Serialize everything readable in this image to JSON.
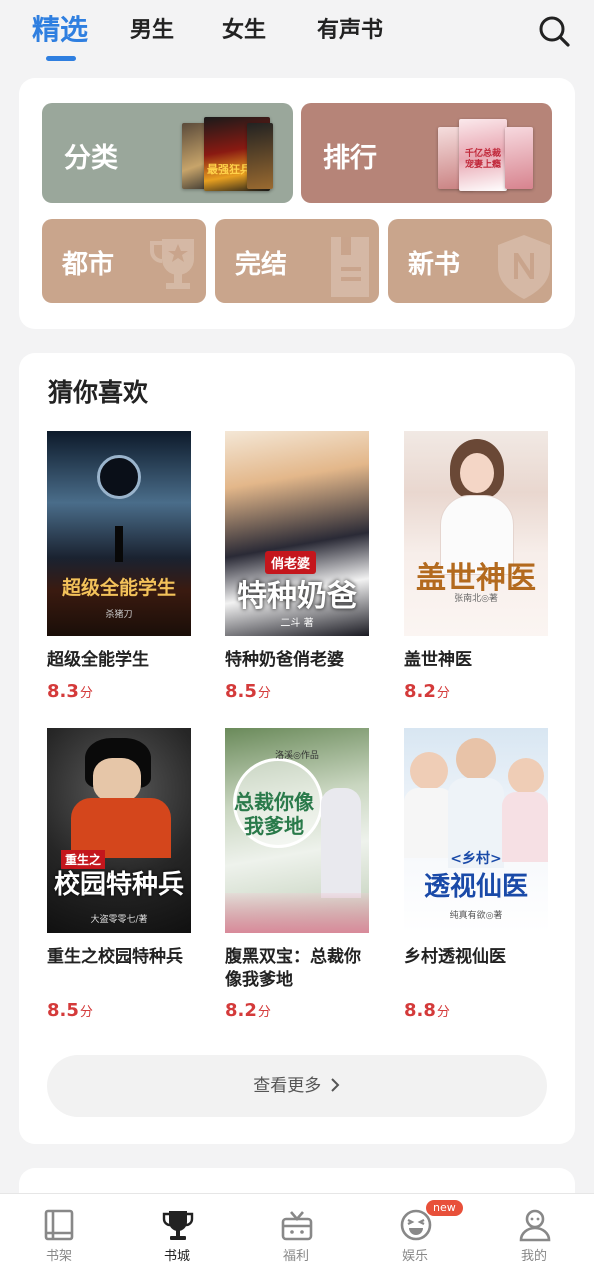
{
  "top_tabs": [
    {
      "label": "精选",
      "active": true
    },
    {
      "label": "男生",
      "active": false
    },
    {
      "label": "女生",
      "active": false
    },
    {
      "label": "有声书",
      "active": false
    }
  ],
  "search": {
    "icon": "search-icon"
  },
  "categories": {
    "big": [
      {
        "label": "分类",
        "color": "#9aa79b",
        "cover_text": "最强狂兵"
      },
      {
        "label": "排行",
        "color": "#b68478",
        "cover_text": "千亿总裁 宠妻上瘾"
      }
    ],
    "small": [
      {
        "label": "都市",
        "color": "#c9a58c",
        "icon": "trophy-icon"
      },
      {
        "label": "完结",
        "color": "#c9a58c",
        "icon": "document-icon"
      },
      {
        "label": "新书",
        "color": "#c9a58c",
        "icon": "new-shield-icon"
      }
    ]
  },
  "recommend": {
    "title": "猜你喜欢",
    "books": [
      {
        "name": "超级全能学生",
        "score": "8.3",
        "unit": "分",
        "cover_title": "超级全能学生",
        "cover_author": "杀猪刀"
      },
      {
        "name": "特种奶爸俏老婆",
        "score": "8.5",
        "unit": "分",
        "cover_title": "特种奶爸",
        "cover_author": "二斗 著"
      },
      {
        "name": "盖世神医",
        "score": "8.2",
        "unit": "分",
        "cover_title": "盖世神医",
        "cover_author": "张南北◎著"
      },
      {
        "name": "重生之校园特种兵",
        "score": "8.5",
        "unit": "分",
        "cover_title": "校园特种兵",
        "cover_author": "大盗零零七/著"
      },
      {
        "name": "腹黑双宝：总裁你像我爹地",
        "score": "8.2",
        "unit": "分",
        "cover_title": "总裁你像我爹地",
        "cover_author": "洛溪◎作品"
      },
      {
        "name": "乡村透视仙医",
        "score": "8.8",
        "unit": "分",
        "cover_title": "透视仙医",
        "cover_author": "纯真有欲◎著"
      }
    ],
    "more_label": "查看更多"
  },
  "bottom_nav": [
    {
      "label": "书架",
      "icon": "bookshelf-icon",
      "active": false
    },
    {
      "label": "书城",
      "icon": "trophy-icon",
      "active": true
    },
    {
      "label": "福利",
      "icon": "gift-icon",
      "active": false
    },
    {
      "label": "娱乐",
      "icon": "smile-icon",
      "active": false,
      "badge": "new"
    },
    {
      "label": "我的",
      "icon": "user-icon",
      "active": false
    }
  ],
  "colors": {
    "accent": "#2f7fe0",
    "score": "#d43a3a",
    "badge": "#e8503a"
  }
}
